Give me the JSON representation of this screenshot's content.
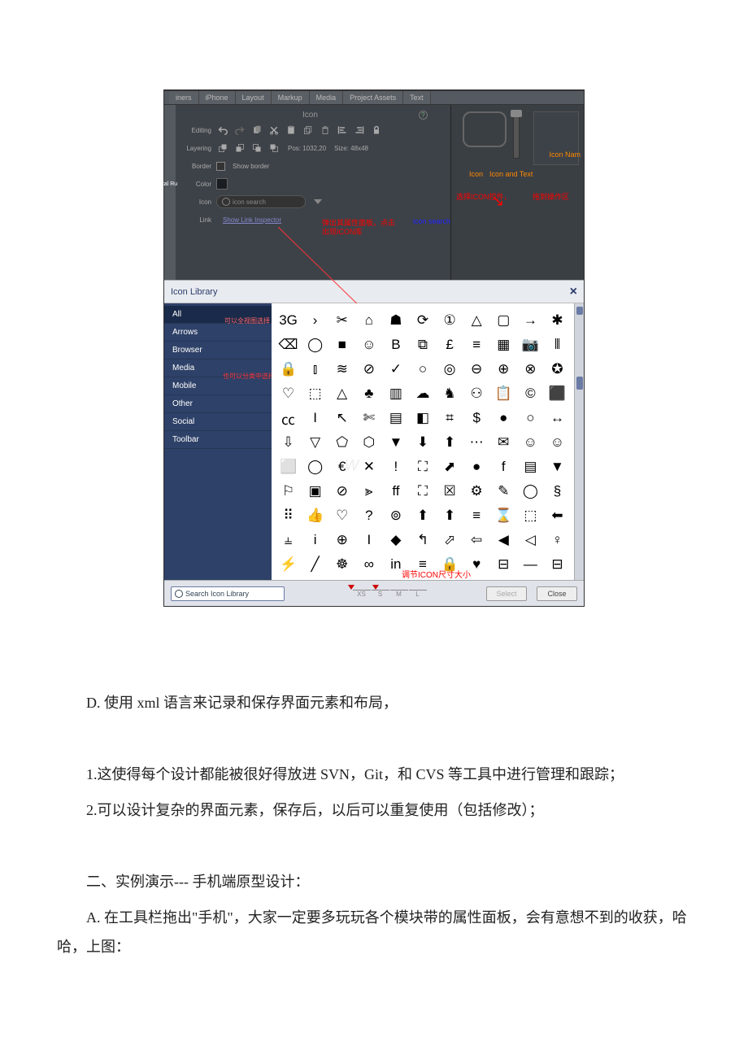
{
  "tabs": {
    "t1": "iners",
    "t2": "iPhone",
    "t3": "Layout",
    "t4": "Markup",
    "t5": "Media",
    "t6": "Project Assets",
    "t7": "Text"
  },
  "inspector": {
    "head": "Icon",
    "rows": {
      "editing": "Editing",
      "layering": "Layering",
      "pos": "Pos: 1032,20",
      "size": "Size: 48x48",
      "border": "Border",
      "show_border": "Show border",
      "color": "Color",
      "icon": "Icon",
      "icon_search": "icon search",
      "link": "Link",
      "link_inspector": "Show Link Inspector"
    }
  },
  "left_sliver": "tal Ru",
  "right_panel": {
    "icon_nam": "Icon Nam",
    "icon": "Icon",
    "icon_and_text": "Icon and Text",
    "red1": "选择ICON控件，",
    "red2": "拖到操作区"
  },
  "popup": {
    "line1": "弹出其属性面板，点击",
    "line2": "出现ICON库",
    "blue": "icon search"
  },
  "library": {
    "title": "Icon Library",
    "cats": {
      "all": "All",
      "arrows": "Arrows",
      "browser": "Browser",
      "media": "Media",
      "mobile": "Mobile",
      "other": "Other",
      "social": "Social",
      "toolbar": "Toolbar"
    },
    "cat_annot_all": "可以全视图选择",
    "cat_annot_media": "也可以分类中选择",
    "footer_search": "Search Icon Library",
    "sizes": {
      "xs": "XS",
      "s": "S",
      "m": "M",
      "l": "L"
    },
    "size_annot": "调节ICON尺寸大小",
    "select": "Select",
    "close": "Close"
  },
  "doc": {
    "d_line": "D. 使用 xml 语言来记录和保存界面元素和布局，",
    "p1": "1.这使得每个设计都能被很好得放进 SVN，Git，和 CVS 等工具中进行管理和跟踪；",
    "p2": "2.可以设计复杂的界面元素，保存后，以后可以重复使用（包括修改）；",
    "h2": "二、实例演示--- 手机端原型设计：",
    "a_line": "A. 在工具栏拖出\"手机\"，大家一定要多玩玩各个模块带的属性面板，会有意想不到的收获，哈哈，上图："
  },
  "icons_grid": [
    "3G",
    "›",
    "✂",
    "⌂",
    "☗",
    "⟳",
    "①",
    "△",
    "▢",
    "→",
    "✱",
    "⌫",
    "◯",
    "■",
    "☺",
    "B",
    "⧉",
    "£",
    "≡",
    "▦",
    "📷",
    "⫴",
    "🔒",
    "⫾",
    "≋",
    "⊘",
    "✓",
    "○",
    "◎",
    "⊖",
    "⊕",
    "⊗",
    "✪",
    "♡",
    "⬚",
    "△",
    "♣",
    "▥",
    "☁",
    "♞",
    "⚇",
    "📋",
    "©",
    "⬛",
    "㏄",
    "I",
    "↖",
    "✄",
    "▤",
    "◧",
    "⌗",
    "$",
    "●",
    "○",
    "↔",
    "⇩",
    "▽",
    "⬠",
    "⬡",
    "▼",
    "⬇",
    "⬆",
    "⋯",
    "✉",
    "☺",
    "☺",
    "⬜",
    "◯",
    "€",
    "✕",
    "!",
    "⛶",
    "⬈",
    "●",
    "f",
    "▤",
    "▼",
    "⚐",
    "▣",
    "⊘",
    "⪢",
    "ff",
    "⛶",
    "☒",
    "⚙",
    "✎",
    "◯",
    "§",
    "⠿",
    "👍",
    "♡",
    "?",
    "⊚",
    "⬆",
    "⬆",
    "≡",
    "⌛",
    "⬚",
    "⬅",
    "⫨",
    "i",
    "⊕",
    "I",
    "◆",
    "↰",
    "⬀",
    "⇦",
    "◀",
    "◁",
    "♀",
    "⚡",
    "╱",
    "☸",
    "∞",
    "in",
    "≡",
    "🔒",
    "♥",
    "⊟",
    "—",
    "⊟"
  ]
}
